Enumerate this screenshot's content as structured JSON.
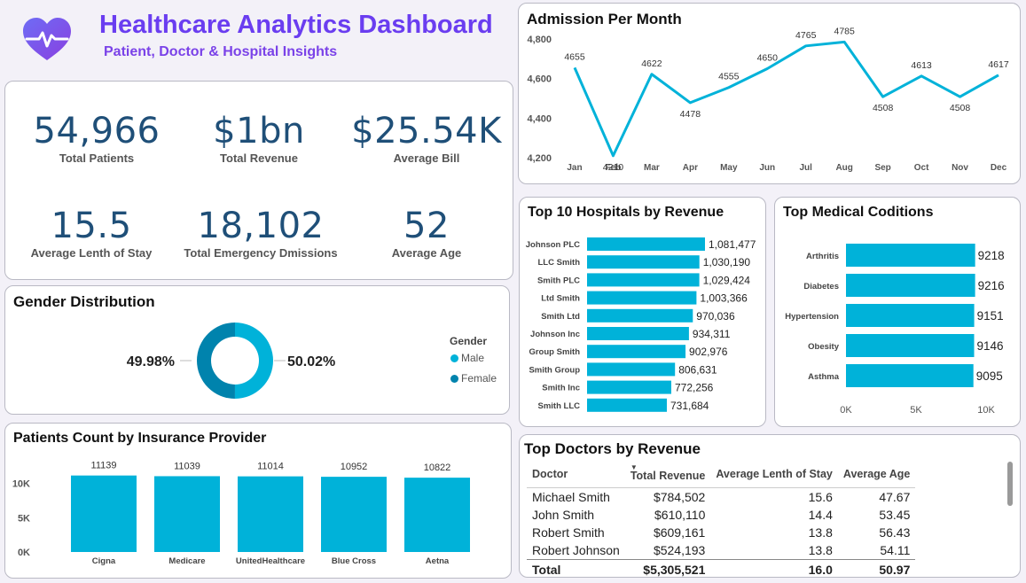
{
  "header": {
    "title": "Healthcare Analytics Dashboard",
    "subtitle": "Patient, Doctor & Hospital Insights",
    "logo_icon": "heart-pulse-icon"
  },
  "kpis": [
    {
      "value": "54,966",
      "label": "Total Patients"
    },
    {
      "value": "$1bn",
      "label": "Total Revenue"
    },
    {
      "value": "$25.54K",
      "label": "Average Bill"
    },
    {
      "value": "15.5",
      "label": "Average Lenth of Stay"
    },
    {
      "value": "18,102",
      "label": "Total Emergency Dmissions"
    },
    {
      "value": "52",
      "label": "Average Age"
    }
  ],
  "colors": {
    "accent": "#00b2d9",
    "female": "#0083ad",
    "kpi": "#1f4f78",
    "title": "#6a3df0"
  },
  "gender": {
    "title": "Gender Distribution",
    "legend_title": "Gender",
    "left_label": "49.98%",
    "right_label": "50.02%",
    "male_label": "Male",
    "female_label": "Female"
  },
  "doctors": {
    "title": "Top Doctors by Revenue",
    "columns": [
      "Doctor",
      "Total Revenue",
      "Average Lenth of Stay",
      "Average Age"
    ],
    "rows": [
      [
        "Michael Smith",
        "$784,502",
        "15.6",
        "47.67"
      ],
      [
        "John Smith",
        "$610,110",
        "14.4",
        "53.45"
      ],
      [
        "Robert Smith",
        "$609,161",
        "13.8",
        "56.43"
      ],
      [
        "Robert Johnson",
        "$524,193",
        "13.8",
        "54.11"
      ]
    ],
    "total": [
      "Total",
      "$5,305,521",
      "16.0",
      "50.97"
    ]
  },
  "chart_data": [
    {
      "id": "admissions",
      "type": "line",
      "title": "Admission Per Month",
      "categories": [
        "Jan",
        "Feb",
        "Mar",
        "Apr",
        "May",
        "Jun",
        "Jul",
        "Aug",
        "Sep",
        "Oct",
        "Nov",
        "Dec"
      ],
      "values": [
        4655,
        4210,
        4622,
        4478,
        4555,
        4650,
        4765,
        4785,
        4508,
        4613,
        4508,
        4617
      ],
      "ylim": [
        4200,
        4800
      ],
      "yticks": [
        4200,
        4400,
        4600,
        4800
      ],
      "ytick_labels": [
        "4,200",
        "4,400",
        "4,600",
        "4,800"
      ]
    },
    {
      "id": "hospitals",
      "type": "bar",
      "orientation": "horizontal",
      "title": "Top 10 Hospitals by Revenue",
      "categories": [
        "Johnson PLC",
        "LLC Smith",
        "Smith PLC",
        "Ltd Smith",
        "Smith Ltd",
        "Johnson Inc",
        "Group Smith",
        "Smith Group",
        "Smith Inc",
        "Smith LLC"
      ],
      "values": [
        1081477,
        1030190,
        1029424,
        1003366,
        970036,
        934311,
        902976,
        806631,
        772256,
        731684
      ],
      "value_labels": [
        "1,081,477",
        "1,030,190",
        "1,029,424",
        "1,003,366",
        "970,036",
        "934,311",
        "902,976",
        "806,631",
        "772,256",
        "731,684"
      ]
    },
    {
      "id": "conditions",
      "type": "bar",
      "orientation": "horizontal",
      "title": "Top Medical Coditions",
      "categories": [
        "Arthritis",
        "Diabetes",
        "Hypertension",
        "Obesity",
        "Asthma"
      ],
      "values": [
        9218,
        9216,
        9151,
        9146,
        9095
      ],
      "xlim": [
        0,
        10000
      ],
      "xticks": [
        0,
        5000,
        10000
      ],
      "xtick_labels": [
        "0K",
        "5K",
        "10K"
      ]
    },
    {
      "id": "insurance",
      "type": "bar",
      "title": "Patients Count by Insurance Provider",
      "categories": [
        "Cigna",
        "Medicare",
        "UnitedHealthcare",
        "Blue Cross",
        "Aetna"
      ],
      "values": [
        11139,
        11039,
        11014,
        10952,
        10822
      ],
      "ylim": [
        0,
        12000
      ],
      "yticks": [
        0,
        5000,
        10000
      ],
      "ytick_labels": [
        "0K",
        "5K",
        "10K"
      ]
    },
    {
      "id": "gender",
      "type": "pie",
      "title": "Gender Distribution",
      "categories": [
        "Male",
        "Female"
      ],
      "values": [
        50.02,
        49.98
      ]
    }
  ]
}
